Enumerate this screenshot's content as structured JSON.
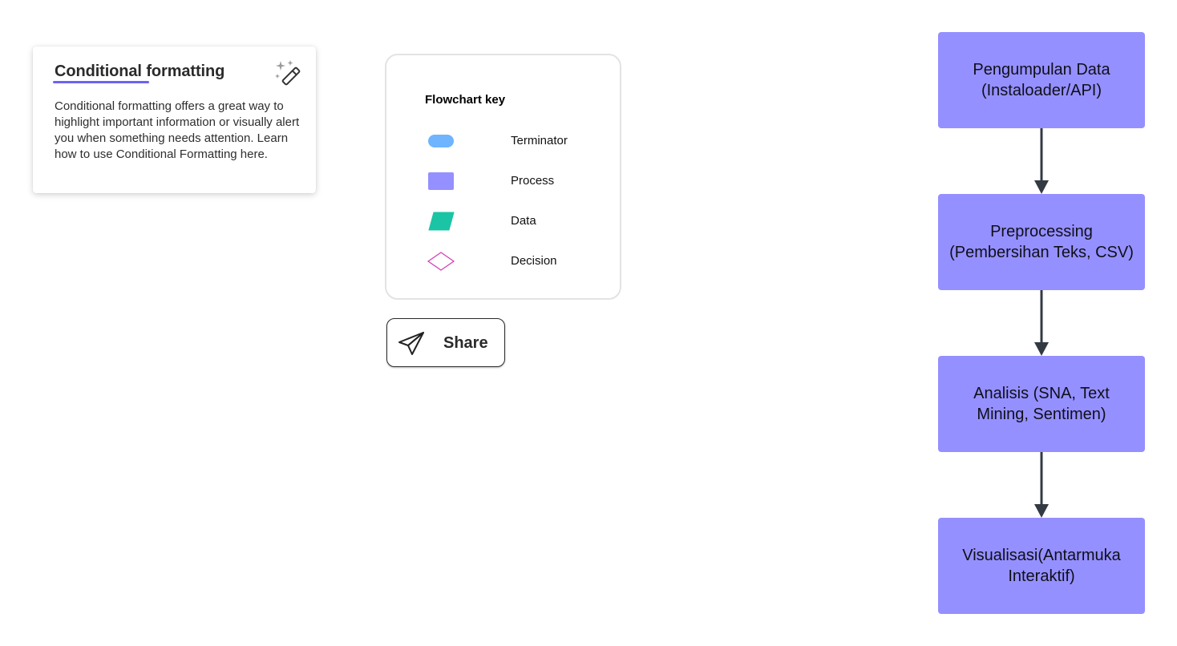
{
  "conditional_formatting": {
    "title": "Conditional formatting",
    "body": "Conditional formatting offers a great way to highlight important information or visually alert you when something needs attention. Learn how to use Conditional Formatting here.",
    "icon": "magic-wand-icon",
    "accent_color": "#6b63f5"
  },
  "flowchart_key": {
    "title": "Flowchart key",
    "items": [
      {
        "label": "Terminator",
        "shape": "terminator",
        "color": "#6eb4ff"
      },
      {
        "label": "Process",
        "shape": "process",
        "color": "#9590ff"
      },
      {
        "label": "Data",
        "shape": "data",
        "color": "#1bc4a4"
      },
      {
        "label": "Decision",
        "shape": "decision",
        "color": "#d43bb5"
      }
    ]
  },
  "share": {
    "label": "Share",
    "icon": "paper-plane-icon"
  },
  "flowchart": {
    "node_color": "#9590ff",
    "arrow_color": "#333a44",
    "nodes": [
      {
        "text": "Pengumpulan Data (Instaloader/API)"
      },
      {
        "text": "Preprocessing (Pembersihan Teks, CSV)"
      },
      {
        "text": "Analisis (SNA, Text Mining, Sentimen)"
      },
      {
        "text": "Visualisasi(Antarmuka Interaktif)"
      }
    ]
  }
}
